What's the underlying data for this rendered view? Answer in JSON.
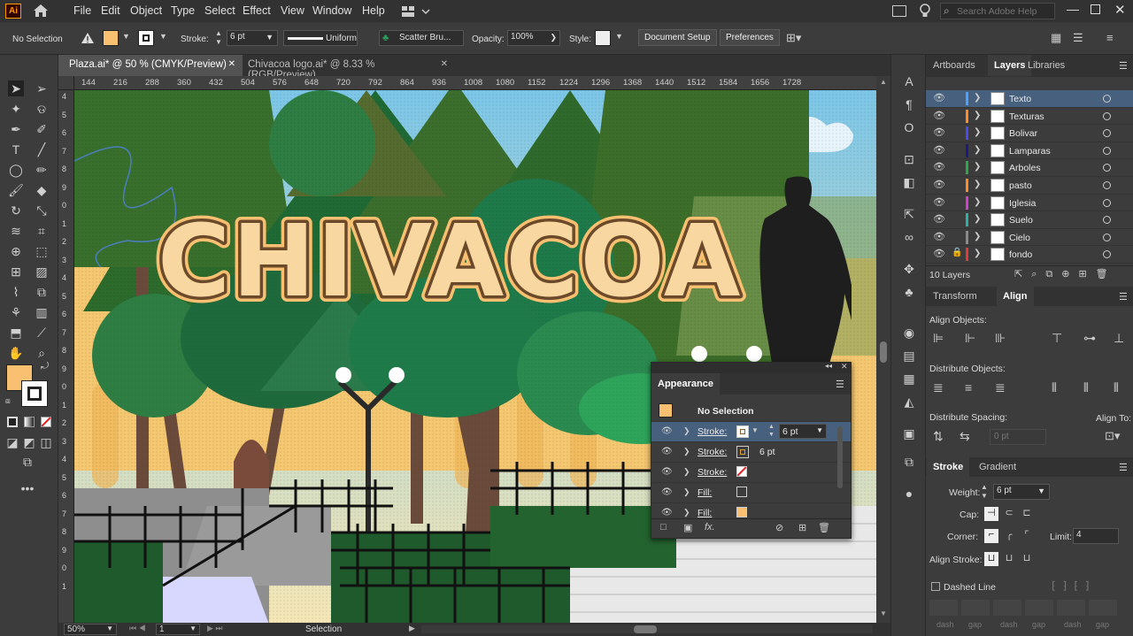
{
  "app": {
    "logo": "Ai"
  },
  "menu": [
    "File",
    "Edit",
    "Object",
    "Type",
    "Select",
    "Effect",
    "View",
    "Window",
    "Help"
  ],
  "search": {
    "placeholder": "Search Adobe Help"
  },
  "control": {
    "selection": "No Selection",
    "stroke_label": "Stroke:",
    "stroke_value": "6 pt",
    "uniform": "Uniform",
    "brush": "Scatter Bru...",
    "opacity_label": "Opacity:",
    "opacity_value": "100%",
    "style_label": "Style:",
    "doc_setup": "Document Setup",
    "preferences": "Preferences"
  },
  "tabs": [
    {
      "label": "Plaza.ai* @ 50 % (CMYK/Preview)"
    },
    {
      "label": "Chivacoa logo.ai* @ 8.33 % (RGB/Preview)"
    }
  ],
  "ruler_h": [
    "144",
    "216",
    "288",
    "360",
    "432",
    "504",
    "576",
    "648",
    "720",
    "792",
    "864",
    "936",
    "1008",
    "1080",
    "1152",
    "1224",
    "1296",
    "1368",
    "1440",
    "1512",
    "1584",
    "1656",
    "1728"
  ],
  "ruler_v": [
    "4",
    "5",
    "6",
    "7",
    "8",
    "9",
    "0",
    "1",
    "2",
    "3",
    "4",
    "5",
    "6",
    "7",
    "8",
    "9",
    "0",
    "1",
    "2",
    "3",
    "4",
    "5",
    "6",
    "7",
    "8",
    "9",
    "0",
    "1"
  ],
  "artwork": {
    "headline": "CHIVACOA"
  },
  "status": {
    "zoom": "50%",
    "artboard": "1",
    "tool": "Selection"
  },
  "layers_panel": {
    "tabs": [
      "Artboards",
      "Layers",
      "Libraries"
    ],
    "count": "10 Layers",
    "layers": [
      {
        "name": "Texto",
        "color": "#4aa3ff"
      },
      {
        "name": "Texturas",
        "color": "#ff8a2a"
      },
      {
        "name": "Bolivar",
        "color": "#4a4af0"
      },
      {
        "name": "Lamparas",
        "color": "#1a1a80"
      },
      {
        "name": "Arboles",
        "color": "#2aa84a"
      },
      {
        "name": "pasto",
        "color": "#ff8a2a"
      },
      {
        "name": "Iglesia",
        "color": "#d040d0"
      },
      {
        "name": "Suelo",
        "color": "#30b0a0"
      },
      {
        "name": "Cielo",
        "color": "#8a8a8a"
      },
      {
        "name": "fondo",
        "color": "#e03a3a"
      }
    ]
  },
  "align_panel": {
    "tabs": [
      "Transform",
      "Align"
    ],
    "align_objects": "Align Objects:",
    "distribute_objects": "Distribute Objects:",
    "distribute_spacing": "Distribute Spacing:",
    "align_to": "Align To:",
    "spacing_value": "0 pt"
  },
  "stroke_panel": {
    "tabs": [
      "Stroke",
      "Gradient"
    ],
    "weight_label": "Weight:",
    "weight_value": "6 pt",
    "cap_label": "Cap:",
    "corner_label": "Corner:",
    "limit_label": "Limit:",
    "limit_value": "4",
    "align_stroke_label": "Align Stroke:",
    "dashed_label": "Dashed Line",
    "dash_labels": [
      "dash",
      "gap",
      "dash",
      "gap",
      "dash",
      "gap"
    ]
  },
  "appearance_panel": {
    "title": "Appearance",
    "header": "No Selection",
    "rows": [
      {
        "label": "Stroke:",
        "value": "6 pt"
      },
      {
        "label": "Stroke:",
        "value": "6 pt"
      },
      {
        "label": "Stroke:",
        "value": ""
      },
      {
        "label": "Fill:",
        "value": ""
      },
      {
        "label": "Fill:",
        "value": ""
      }
    ]
  }
}
